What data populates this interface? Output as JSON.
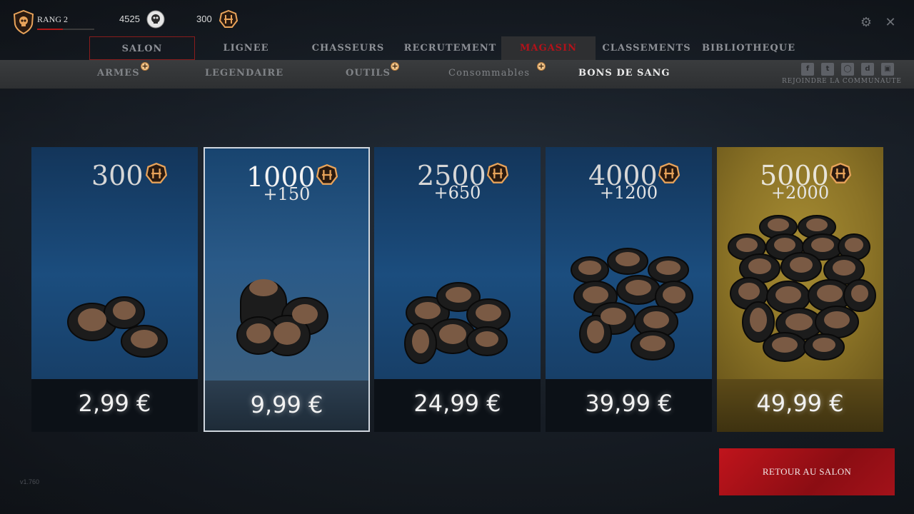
{
  "rank": {
    "label": "RANG 2",
    "progress_pct": 45
  },
  "currencies": [
    {
      "name": "bloodline-currency",
      "value": "4525",
      "icon": "skull-coin-icon"
    },
    {
      "name": "blood-bonds",
      "value": "300",
      "icon": "blood-bond-icon"
    }
  ],
  "main_nav": [
    "SALON",
    "LIGNEE",
    "CHASSEURS",
    "RECRUTEMENT",
    "MAGASIN",
    "CLASSEMENTS",
    "BIBLIOTHEQUE"
  ],
  "sub_nav": [
    "ARMES",
    "LEGENDAIRE",
    "OUTILS",
    "Consommables",
    "BONS DE SANG"
  ],
  "community": {
    "label": "REJOINDRE LA COMMUNAUTE",
    "icons": [
      "facebook-icon",
      "twitter-icon",
      "instagram-icon",
      "discord-icon",
      "twitch-icon"
    ]
  },
  "offers": [
    {
      "amount": "300",
      "bonus": "",
      "price": "2,99 €"
    },
    {
      "amount": "1000",
      "bonus": "+150",
      "price": "9,99 €"
    },
    {
      "amount": "2500",
      "bonus": "+650",
      "price": "24,99 €"
    },
    {
      "amount": "4000",
      "bonus": "+1200",
      "price": "39,99 €"
    },
    {
      "amount": "5000",
      "bonus": "+2000",
      "price": "49,99 €"
    }
  ],
  "return_button": "RETOUR AU SALON",
  "version": "v1.760",
  "colors": {
    "accent_red": "#b3121a",
    "token_orange": "#e8a35a",
    "gold_card": "#8a7226"
  }
}
